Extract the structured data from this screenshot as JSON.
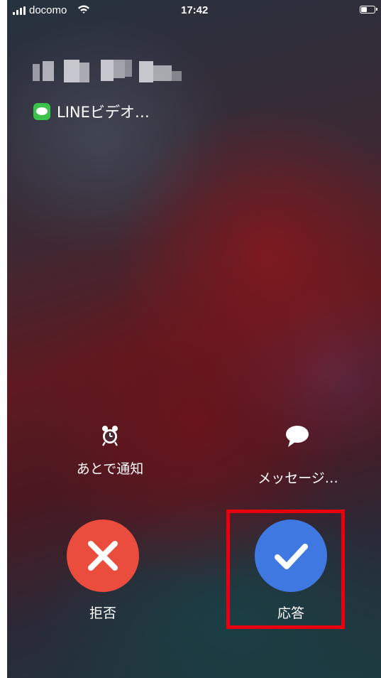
{
  "status_bar": {
    "carrier": "docomo",
    "time": "17:42",
    "battery_level": 0.4
  },
  "caller": {
    "app_label": "LINEビデオ…"
  },
  "actions": {
    "remind_label": "あとで通知",
    "message_label": "メッセージ…",
    "decline_label": "拒否",
    "accept_label": "応答"
  },
  "icons": {
    "remind": "alarm-clock-icon",
    "message": "speech-bubble-icon",
    "decline": "x-icon",
    "accept": "checkmark-icon"
  },
  "colors": {
    "decline": "#ea4d3d",
    "accept": "#3f78e0",
    "line_brand": "#3ac24a",
    "highlight": "#e8000f"
  }
}
